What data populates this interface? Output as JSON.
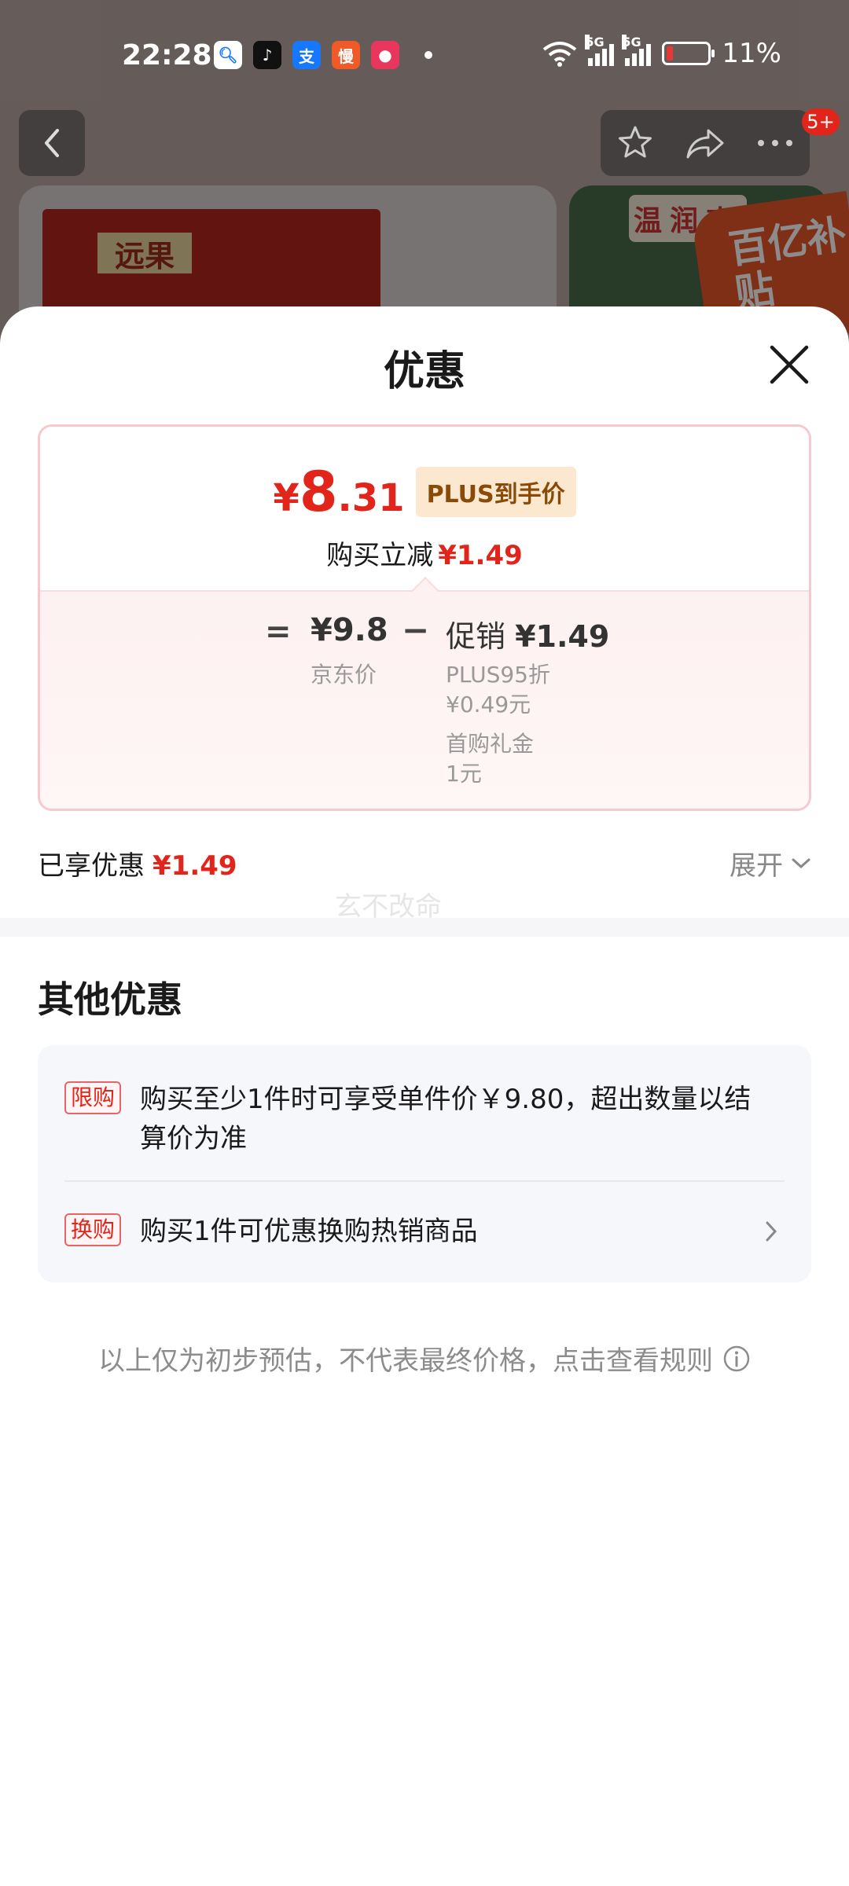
{
  "status_bar": {
    "time": "22:28",
    "network_1": "5G",
    "network_2": "5G",
    "battery": "11%"
  },
  "background": {
    "badge": "5+",
    "product_logo": "远果",
    "thumb_text": "温润爽",
    "subsidy": "百亿补贴"
  },
  "sheet": {
    "title": "优惠",
    "price": {
      "currency": "¥",
      "integer": "8",
      "decimal": ".31",
      "tag": "PLUS到手价",
      "instant_label": "购买立减",
      "instant_value": "¥1.49"
    },
    "calc": {
      "equals": "=",
      "jd_price": "¥9.8",
      "jd_label": "京东价",
      "minus": "−",
      "promo_label": "促销",
      "promo_value": "¥1.49",
      "details": [
        "PLUS95折",
        "¥0.49元",
        "首购礼金",
        "1元"
      ]
    },
    "enjoyed_label": "已享优惠",
    "enjoyed_value": "¥1.49",
    "expand_label": "展开",
    "watermark": "玄不改命"
  },
  "other": {
    "title": "其他优惠",
    "rows": [
      {
        "tag": "限购",
        "text": "购买至少1件时可享受单件价￥9.80，超出数量以结算价为准"
      },
      {
        "tag": "换购",
        "text": "购买1件可优惠换购热销商品"
      }
    ]
  },
  "disclaimer": "以上仅为初步预估，不代表最终价格，点击查看规则",
  "colors": {
    "accent_red": "#e1251b",
    "plus_gold": "#8a4b08"
  }
}
